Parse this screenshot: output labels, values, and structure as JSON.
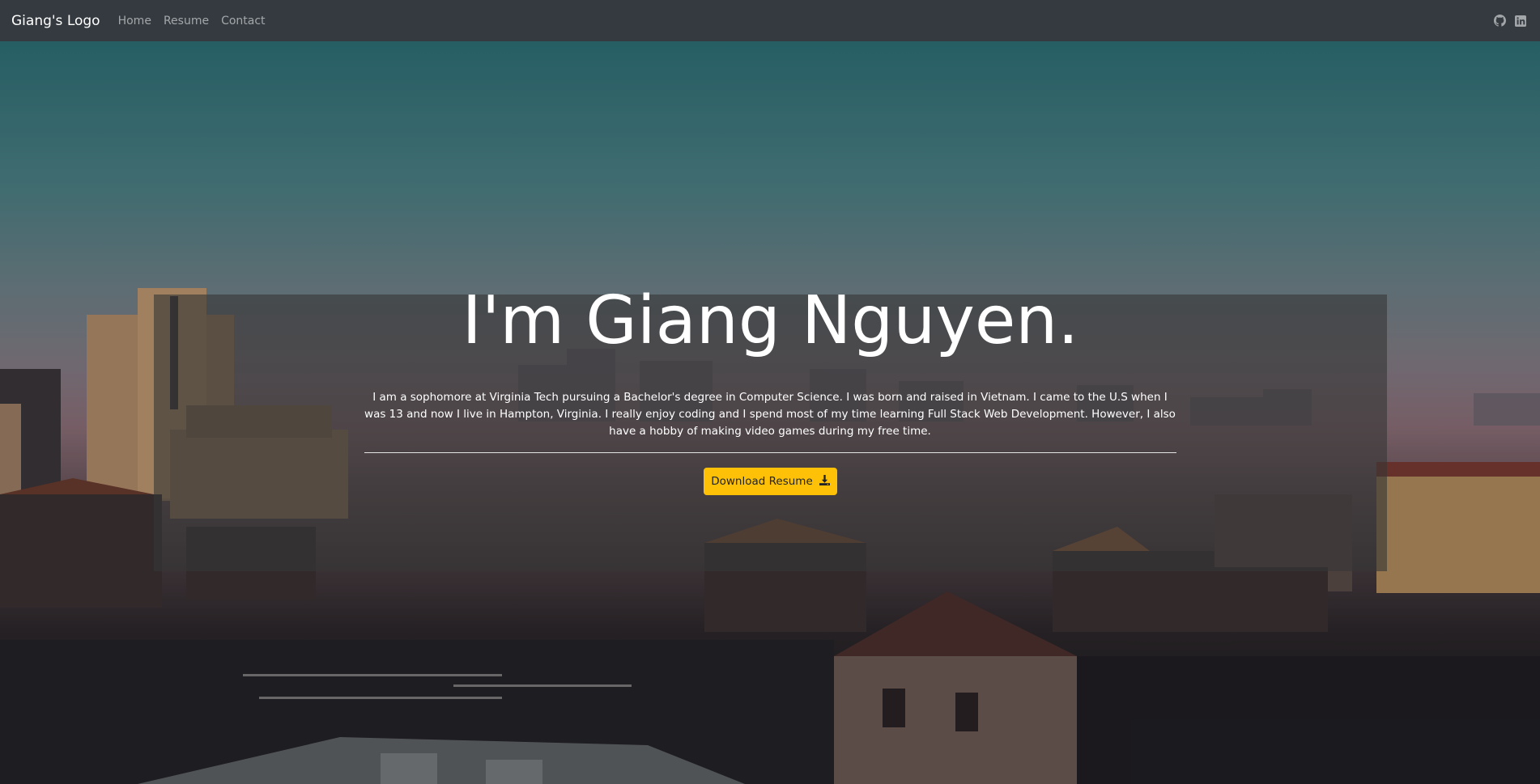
{
  "navbar": {
    "brand": "Giang's Logo",
    "links": [
      {
        "label": "Home"
      },
      {
        "label": "Resume"
      },
      {
        "label": "Contact"
      }
    ],
    "icons": [
      "github-icon",
      "linkedin-icon"
    ]
  },
  "hero": {
    "headline": "I'm Giang Nguyen.",
    "bio": "I am a sophomore at Virginia Tech pursuing a Bachelor's degree in Computer Science. I was born and raised in Vietnam. I came to the U.S when I was 13 and now I live in Hampton, Virginia. I really enjoy coding and I spend most of my time learning Full Stack Web Development. However, I also have a hobby of making video games during my free time.",
    "download_button": {
      "label": "Download Resume",
      "icon": "download-icon"
    }
  },
  "colors": {
    "navbar_bg": "#343a40",
    "button_accent": "#ffc107"
  }
}
